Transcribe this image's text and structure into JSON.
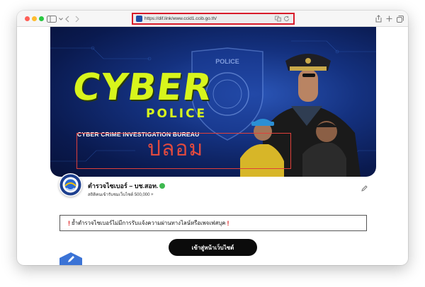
{
  "browser": {
    "url": "https://dif.link/www.ccid1.ccib.go.th/",
    "icons": [
      "sidebar-icon",
      "back-icon",
      "forward-icon",
      "translate-icon",
      "reload-icon",
      "share-icon",
      "new-tab-icon",
      "tabs-overview-icon"
    ]
  },
  "banner": {
    "line1": "CYBER",
    "line2": "POLICE",
    "bureau": "CYBER CRIME INVESTIGATION BUREAU",
    "badge_text": "POLICE",
    "fake_label": "ปลอม",
    "colors": {
      "headline": "#d8f51c",
      "fake": "#e04a3f",
      "background": "#14317f"
    }
  },
  "profile": {
    "name": "ตำรวจไซเบอร์ – บช.สอท.",
    "followers": "สถิติคนเข้ารับชมเว็บไซต์ 500,000 +"
  },
  "notice": {
    "mark": "!",
    "text": "ย้ำตำรวจไซเบอร์ไม่มีการรับแจ้งความผ่านทางไลน์หรือเพจเฟสบุค"
  },
  "cta": {
    "label": "เข้าสู่หน้าเว็บไซต์"
  }
}
